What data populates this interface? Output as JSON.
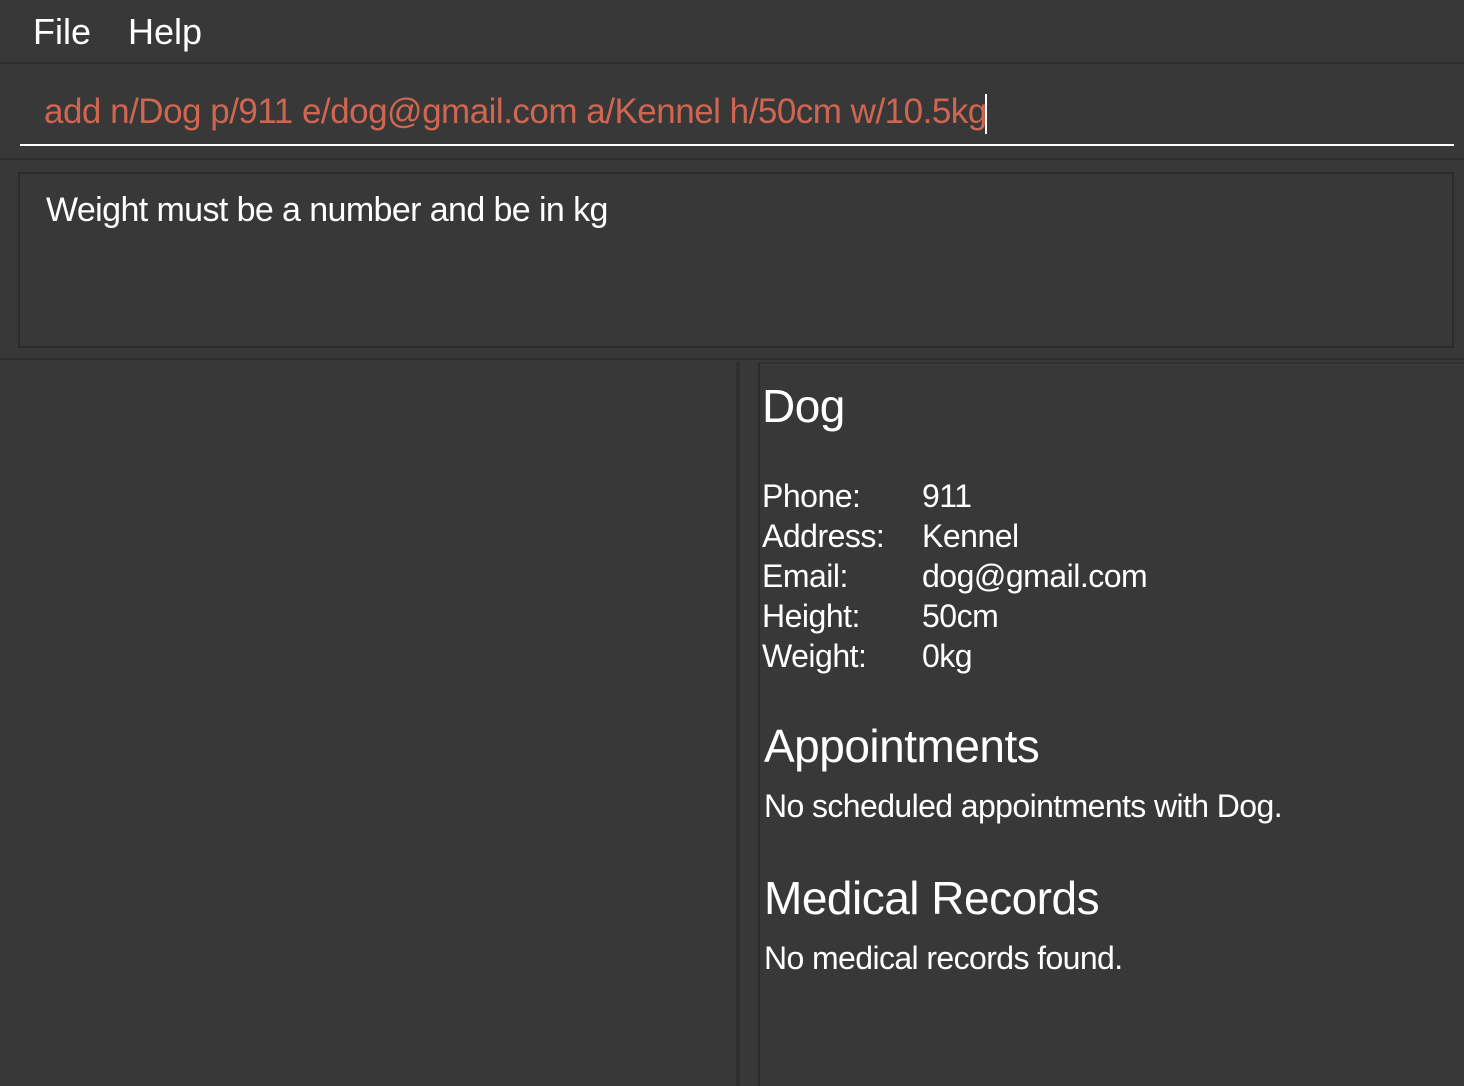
{
  "menu": {
    "file_label": "File",
    "help_label": "Help"
  },
  "command": {
    "value": "add n/Dog p/911 e/dog@gmail.com a/Kennel h/50cm w/10.5kg",
    "text_color": "#d06651"
  },
  "result": {
    "message": "Weight must be a number and be in kg"
  },
  "pet_details": {
    "name": "Dog",
    "fields": [
      {
        "label": "Phone:",
        "value": "911"
      },
      {
        "label": "Address:",
        "value": "Kennel"
      },
      {
        "label": "Email:",
        "value": "dog@gmail.com"
      },
      {
        "label": "Height:",
        "value": "50cm"
      },
      {
        "label": "Weight:",
        "value": "0kg"
      }
    ],
    "appointments_title": "Appointments",
    "appointments_empty": "No scheduled appointments with Dog.",
    "medical_title": "Medical Records",
    "medical_empty": "No medical records found."
  },
  "colors": {
    "background": "#383838",
    "border": "#2c2c2c",
    "error_text": "#d06651"
  }
}
